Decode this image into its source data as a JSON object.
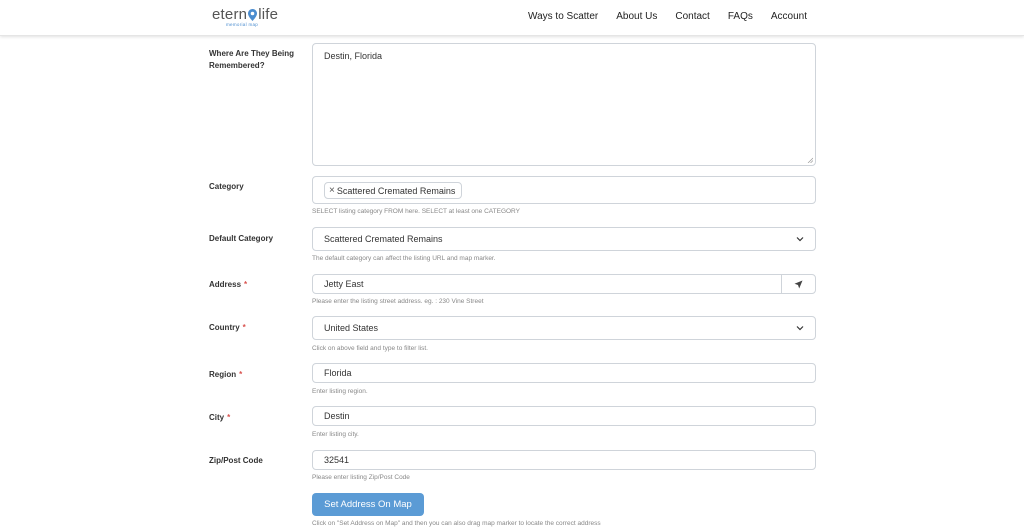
{
  "header": {
    "logo_main": "etern",
    "logo_end": "life",
    "logo_sub": "memorial map",
    "nav": [
      "Ways to Scatter",
      "About Us",
      "Contact",
      "FAQs",
      "Account"
    ]
  },
  "form": {
    "remembered": {
      "label": "Where Are They Being Remembered?",
      "value": "Destin, Florida"
    },
    "category": {
      "label": "Category",
      "chip": "Scattered Cremated Remains",
      "help": "SELECT listing category FROM here. SELECT at least one CATEGORY"
    },
    "default_category": {
      "label": "Default Category",
      "value": "Scattered Cremated Remains",
      "help": "The default category can affect the listing URL and map marker."
    },
    "address": {
      "label": "Address",
      "required": "*",
      "value": "Jetty East",
      "help": "Please enter the listing street address. eg. : 230 Vine Street"
    },
    "country": {
      "label": "Country",
      "required": "*",
      "value": "United States",
      "help": "Click on above field and type to filter list."
    },
    "region": {
      "label": "Region",
      "required": "*",
      "value": "Florida",
      "help": "Enter listing region."
    },
    "city": {
      "label": "City",
      "required": "*",
      "value": "Destin",
      "help": "Enter listing city."
    },
    "zip": {
      "label": "Zip/Post Code",
      "value": "32541",
      "help": "Please enter listing Zip/Post Code"
    },
    "map_button": "Set Address On Map",
    "map_help": "Click on \"Set Address on Map\" and then you can also drag map marker to locate the correct address"
  },
  "colors": {
    "accent": "#5b9bd5",
    "required": "#d9534f",
    "logo_pin": "#4a8ccf"
  }
}
